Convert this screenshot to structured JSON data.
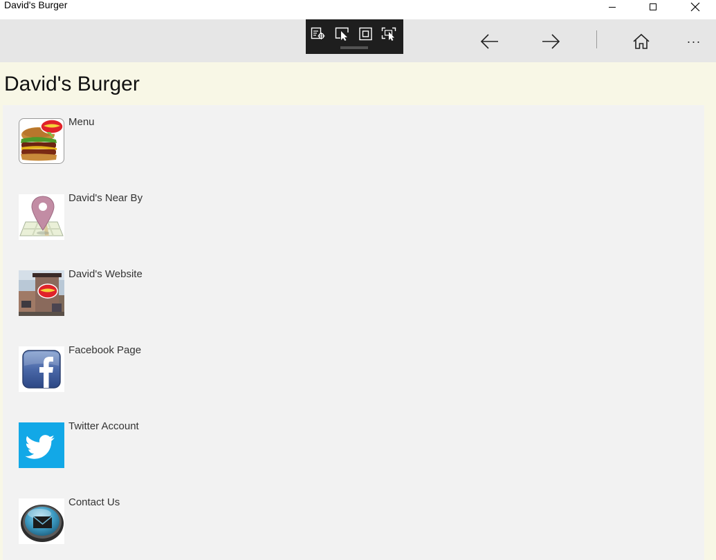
{
  "window": {
    "title": "David's Burger",
    "controls": [
      "minimize",
      "maximize",
      "close"
    ]
  },
  "navbar": {
    "buttons": [
      "back-arrow-icon",
      "forward-arrow-icon",
      "home-icon",
      "more-icon"
    ],
    "more_label": "···"
  },
  "page": {
    "title": "David's Burger",
    "items": [
      {
        "label": "Menu",
        "icon": "burger-icon"
      },
      {
        "label": "David's Near By",
        "icon": "map-pin-icon"
      },
      {
        "label": "David's Website",
        "icon": "restaurant-photo-icon"
      },
      {
        "label": "Facebook Page",
        "icon": "facebook-icon"
      },
      {
        "label": "Twitter Account",
        "icon": "twitter-icon"
      },
      {
        "label": "Contact Us",
        "icon": "mail-icon"
      }
    ]
  },
  "colors": {
    "page_background": "#f8f7e6",
    "panel_background": "#f2f2f2",
    "navbar_background": "#e6e6e6",
    "devtools_background": "#1e1e1e",
    "twitter_blue": "#12a8e7",
    "facebook_blue": "#3b5998"
  }
}
